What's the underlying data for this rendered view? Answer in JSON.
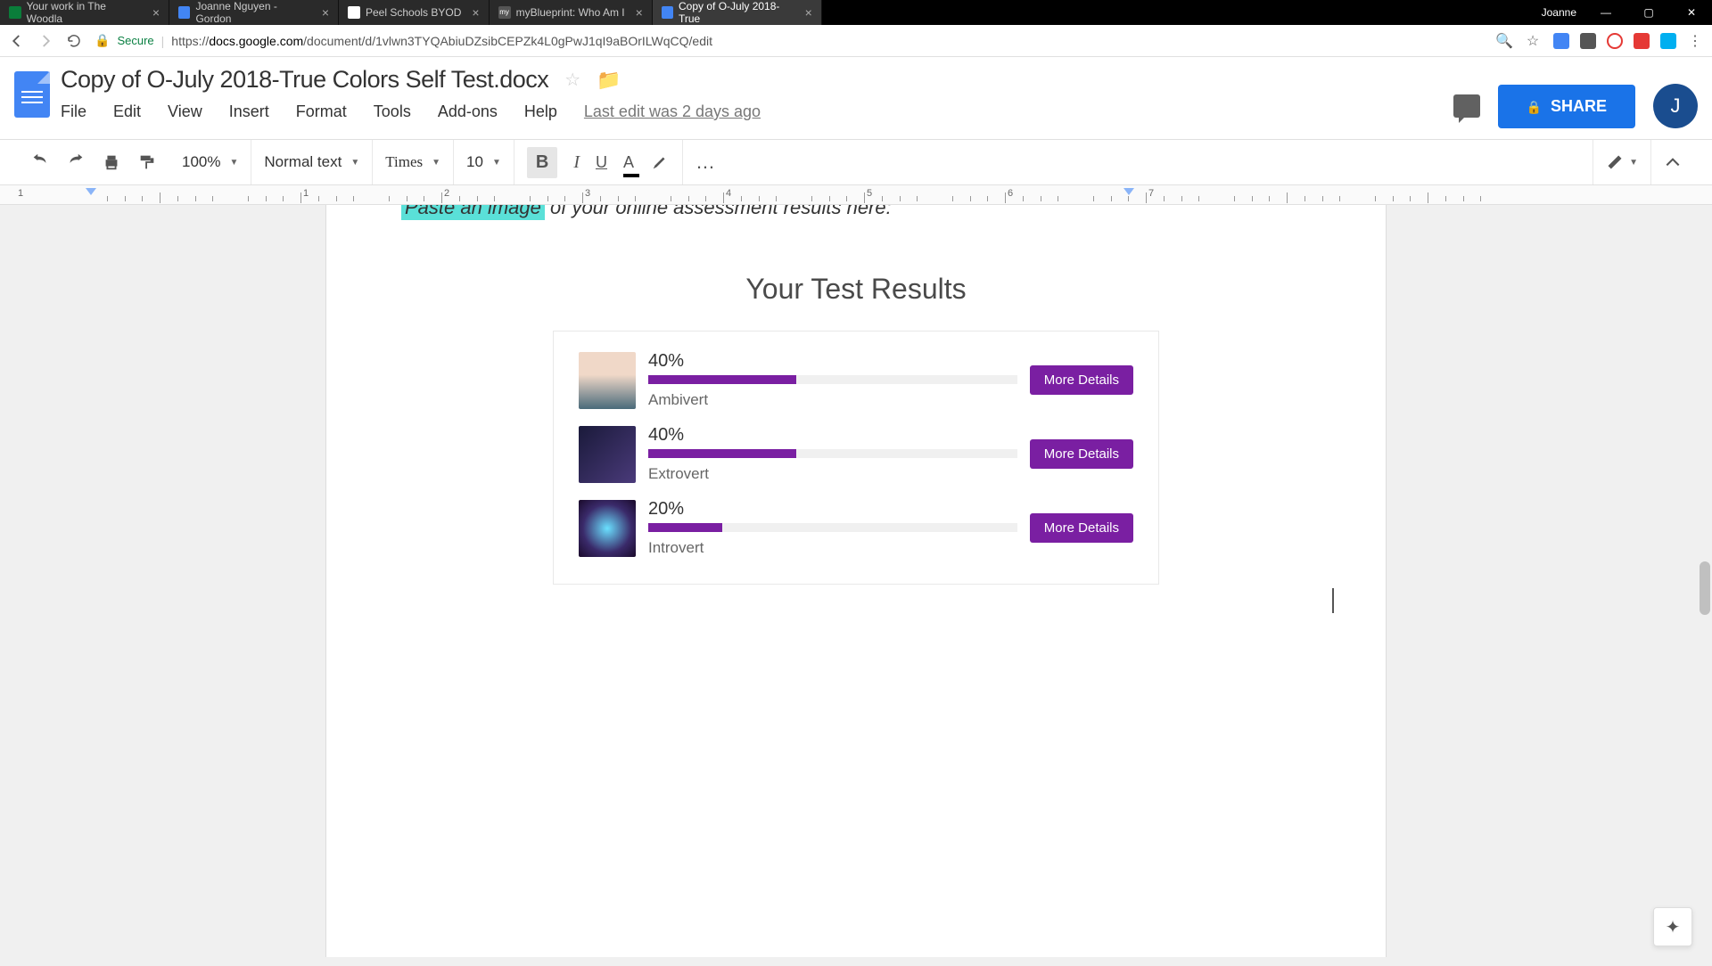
{
  "browser": {
    "user": "Joanne",
    "tabs": [
      {
        "label": "Your work in The Woodla",
        "active": false
      },
      {
        "label": "Joanne Nguyen - Gordon",
        "active": false
      },
      {
        "label": "Peel Schools BYOD",
        "active": false
      },
      {
        "label": "myBlueprint: Who Am I",
        "active": false
      },
      {
        "label": "Copy of O-July 2018-True",
        "active": true
      }
    ],
    "secure_label": "Secure",
    "url_prefix": "https://",
    "url_host": "docs.google.com",
    "url_path": "/document/d/1vlwn3TYQAbiuDZsibCEPZk4L0gPwJ1qI9aBOrILWqCQ/edit"
  },
  "docs": {
    "title": "Copy of O-July 2018-True Colors Self Test.docx",
    "menus": [
      "File",
      "Edit",
      "View",
      "Insert",
      "Format",
      "Tools",
      "Add-ons",
      "Help"
    ],
    "last_edit": "Last edit was 2 days ago",
    "share_label": "SHARE",
    "avatar_letter": "J"
  },
  "toolbar": {
    "zoom": "100%",
    "style": "Normal text",
    "font": "Times",
    "size": "10",
    "bold": "B",
    "italic": "I",
    "underline": "U",
    "text_color": "A",
    "more": "…"
  },
  "ruler": {
    "numbers": [
      "1",
      "1",
      "2",
      "3",
      "4",
      "5",
      "6",
      "7"
    ]
  },
  "document": {
    "cutoff_highlight": "Paste an image",
    "cutoff_rest": " of your online assessment results here:",
    "results_title": "Your Test Results",
    "results": [
      {
        "pct": "40%",
        "fill": 40,
        "label": "Ambivert",
        "btn": "More Details"
      },
      {
        "pct": "40%",
        "fill": 40,
        "label": "Extrovert",
        "btn": "More Details"
      },
      {
        "pct": "20%",
        "fill": 20,
        "label": "Introvert",
        "btn": "More Details"
      }
    ]
  }
}
